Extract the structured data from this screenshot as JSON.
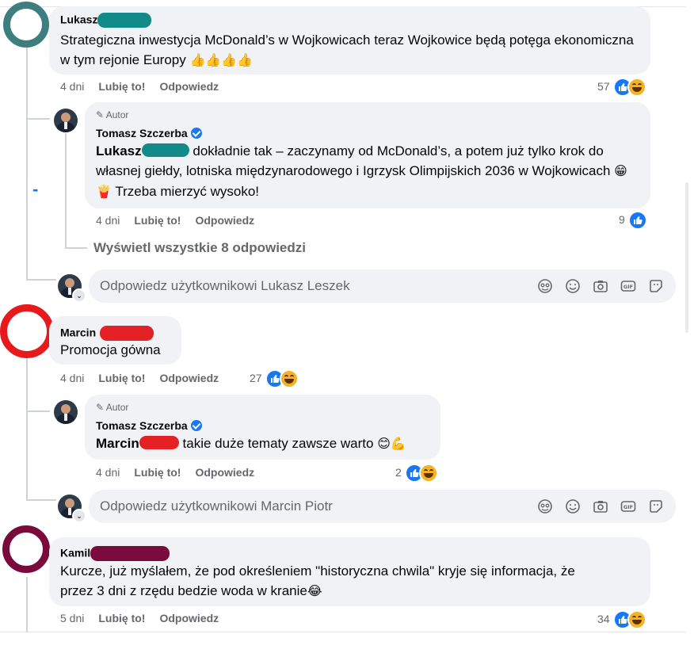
{
  "comments": [
    {
      "author": "Lukasz",
      "text": "Strategiczna inwestycja McDonald’s w Wojkowicach teraz Wojkowice będą potęga ekonomiczna w tym rejonie Europy",
      "emoji": "👍👍👍👍",
      "time": "4 dni",
      "like_label": "Lubię to!",
      "reply_label": "Odpowiedz",
      "reaction_count": "57",
      "ring_color": "#3e7e7f",
      "redact_color": "#138a8a",
      "reply": {
        "badge": "Autor",
        "author": "Tomasz Szczerba",
        "mention": "Lukasz",
        "text": "dokładnie tak – zaczynamy od McDonald’s, a potem już tylko krok do własnej giełdy, lotniska międzynarodowego i Igrzysk Olimpijskich 2036 w Wojkowicach",
        "emoji_after": "😁🍟",
        "tail": "Trzeba mierzyć wysoko!",
        "time": "4 dni",
        "like_label": "Lubię to!",
        "reply_label": "Odpowiedz",
        "reaction_count": "9"
      },
      "view_all": "Wyświetl wszystkie 8 odpowiedzi",
      "reply_placeholder": "Odpowiedz użytkownikowi Lukasz Leszek"
    },
    {
      "author": "Marcin",
      "text": "Promocja gówna",
      "time": "4 dni",
      "like_label": "Lubię to!",
      "reply_label": "Odpowiedz",
      "reaction_count": "27",
      "ring_color": "#e8191c",
      "redact_color": "#e42226",
      "reply": {
        "badge": "Autor",
        "author": "Tomasz Szczerba",
        "mention": "Marcin",
        "text": "takie duże tematy zawsze warto",
        "emoji_after": "😊💪",
        "time": "4 dni",
        "like_label": "Lubię to!",
        "reply_label": "Odpowiedz",
        "reaction_count": "2"
      },
      "reply_placeholder": "Odpowiedz użytkownikowi Marcin Piotr"
    },
    {
      "author": "Kamil",
      "text_line1": "Kurcze, już myślałem, że pod określeniem \"historyczna chwila\" kryje się informacja, że",
      "text_line2": "przez 3 dni z rzędu bedzie woda w kranie",
      "emoji": "😂",
      "time": "5 dni",
      "like_label": "Lubię to!",
      "reply_label": "Odpowiedz",
      "reaction_count": "34",
      "ring_color": "#7b0a3c",
      "redact_color": "#7a0b3d"
    }
  ],
  "composer_icons": [
    "avatar-sticker-icon",
    "emoji-icon",
    "camera-icon",
    "gif-icon",
    "sticker-icon"
  ],
  "collapse_symbol": "-"
}
